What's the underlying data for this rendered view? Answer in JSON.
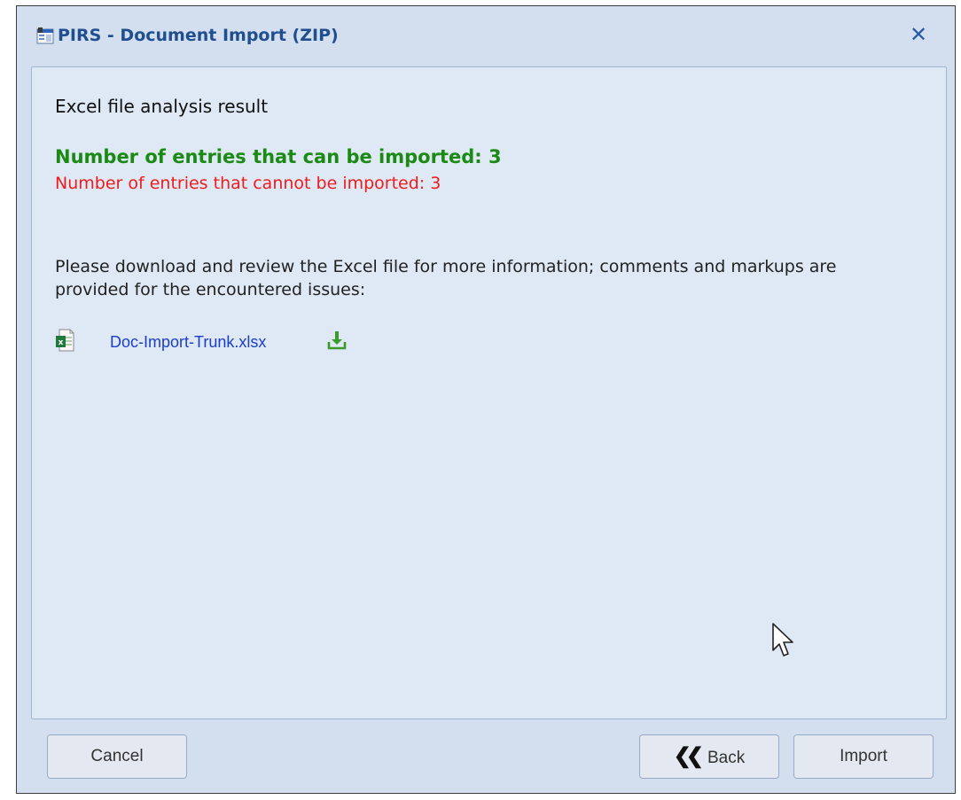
{
  "window": {
    "title": "PIRS - Document Import (ZIP)",
    "close_glyph": "✕"
  },
  "content": {
    "heading": "Excel file analysis result",
    "importable_text": "Number of entries that can be imported: 3",
    "not_importable_text": "Number of entries that cannot be imported: 3",
    "info_text": "Please download and review the Excel file for more information; comments and markups are provided for the encountered issues:",
    "file": {
      "name": "Doc-Import-Trunk.xlsx",
      "icon": "excel-file-icon",
      "action_icon": "download-icon"
    }
  },
  "buttons": {
    "cancel_label": "Cancel",
    "back_label": "Back",
    "back_icon": "double-chevron-left-icon",
    "import_label": "Import"
  },
  "colors": {
    "title": "#1f4f8f",
    "success": "#1a8a14",
    "error": "#ee1c1c",
    "link": "#1b3ec8",
    "dialog_bg": "#d3dfee",
    "panel_bg": "#dfe8f5"
  }
}
